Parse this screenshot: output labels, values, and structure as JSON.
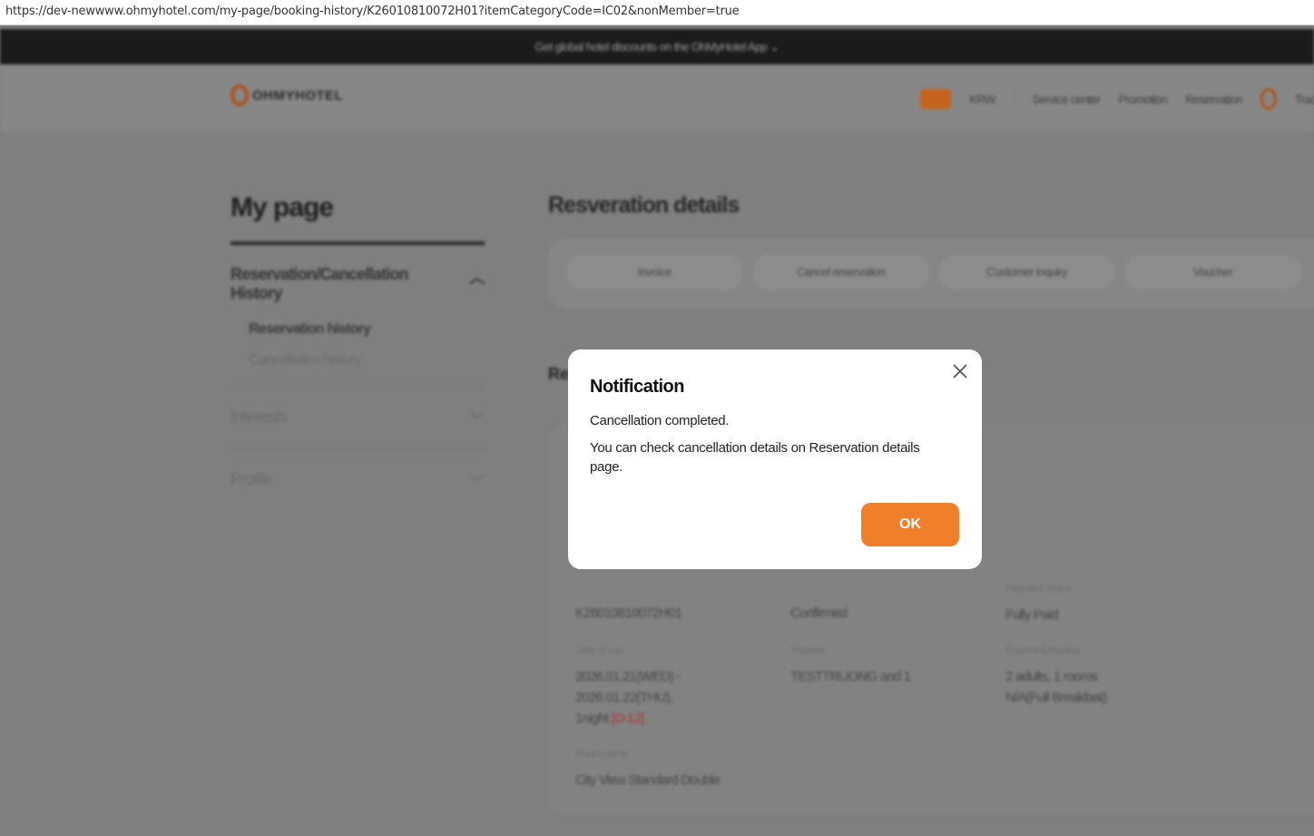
{
  "browser": {
    "url": "https://dev-newwww.ohmyhotel.com/my-page/booking-history/K26010810072H01?itemCategoryCode=IC02&nonMember=true"
  },
  "promo_bar": {
    "text": "Get global hotel discounts on the OhMyHotel App"
  },
  "header": {
    "logo": "OHMYHOTEL",
    "currency": "KRW",
    "nav": [
      "Service center",
      "Promotion",
      "Reservation"
    ],
    "user": "Tracy"
  },
  "sidebar": {
    "title": "My page",
    "group": "Reservation/Cancellation History",
    "subitems": [
      "Reservation history",
      "Cancellation history"
    ],
    "items": [
      "Interests",
      "Profile"
    ]
  },
  "main": {
    "title": "Resveration details",
    "buttons": [
      "Invoice",
      "Cancel reservation",
      "Customer inquiry",
      "Voucher"
    ],
    "section_title": "Re",
    "reservation_no": "K26010810072H01",
    "status": "Confirmed",
    "payment_status_label": "Payment Status",
    "payment_status": "Fully Paid",
    "date_label": "Date of use",
    "date_line1": "2026.01.21(WED) -",
    "date_line2": "2026.01.22(THU),",
    "nights": "1night",
    "dday": "[D-12]",
    "traveler_label": "Traveler",
    "traveler": "TESTTRUONG and 1",
    "room_info_label": "Room information",
    "room_info1": "2 adults, 1 rooms",
    "room_info2": "N/A(Full Breakfast)",
    "room_name_label": "Room name",
    "room_name": "City View Standard Double"
  },
  "modal": {
    "title": "Notification",
    "line1": "Cancellation completed.",
    "line2": "You can check cancellation details on Reservation details page.",
    "ok_label": "OK"
  },
  "colors": {
    "accent": "#ef7f2a"
  }
}
